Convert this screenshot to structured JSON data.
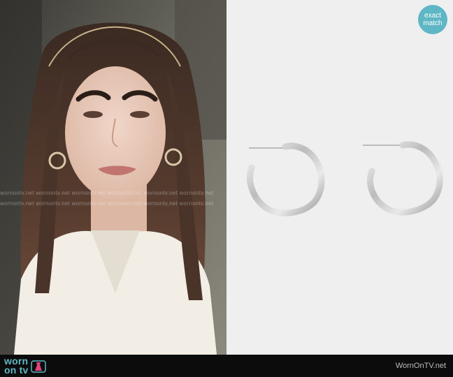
{
  "badge": {
    "line1": "exact",
    "line2": "match"
  },
  "watermark": {
    "text": "wornontv.net wornontv.net wornontv.net wornontv.net wornontv.net wornontv.net"
  },
  "footer": {
    "logo_line1": "worn",
    "logo_line2": "on tv",
    "site": "WornOnTV.net"
  },
  "colors": {
    "accent": "#5fb7c5",
    "footer_bg": "#0c0c0c"
  }
}
